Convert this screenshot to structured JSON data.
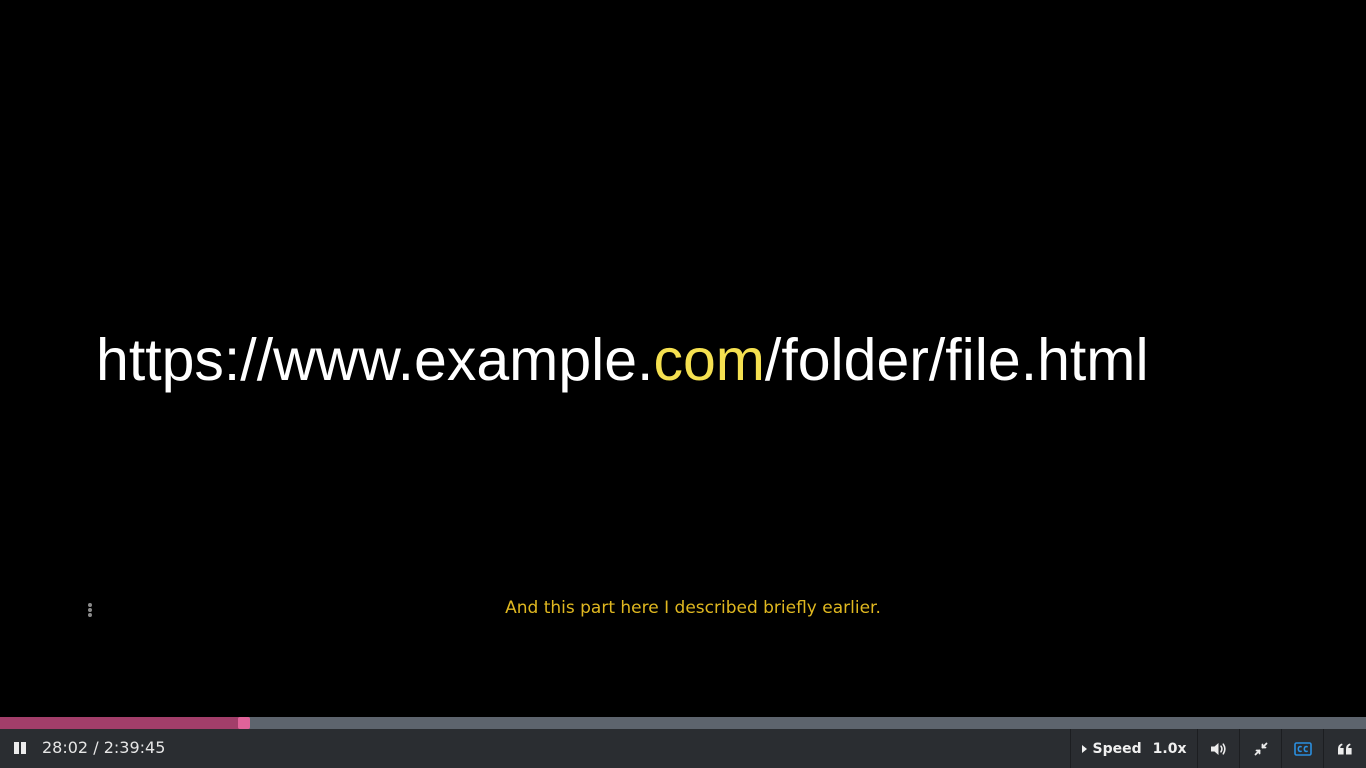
{
  "slide": {
    "url_prefix": "https://www.example.",
    "url_highlight": "com",
    "url_suffix": "/folder/file.html"
  },
  "caption": {
    "text": "And this part here I described briefly earlier.",
    "menu_icon": "vertical-dots-icon"
  },
  "progress": {
    "played_fraction": 0.175
  },
  "controls": {
    "play_state_icon": "pause-icon",
    "current_time": "28:02",
    "separator": "/",
    "duration": "2:39:45",
    "time_display": "28:02 / 2:39:45",
    "speed_label": "Speed",
    "speed_value": "1.0x",
    "volume_icon": "volume-icon",
    "fullscreen_icon": "exit-fullscreen-icon",
    "cc_icon": "closed-captions-icon",
    "transcript_icon": "quote-icon"
  },
  "colors": {
    "accent_progress": "#a23e6a",
    "progress_handle": "#e0639a",
    "caption": "#e0b820",
    "url_highlight": "#f5e050",
    "cc_active": "#2a8fe0"
  }
}
